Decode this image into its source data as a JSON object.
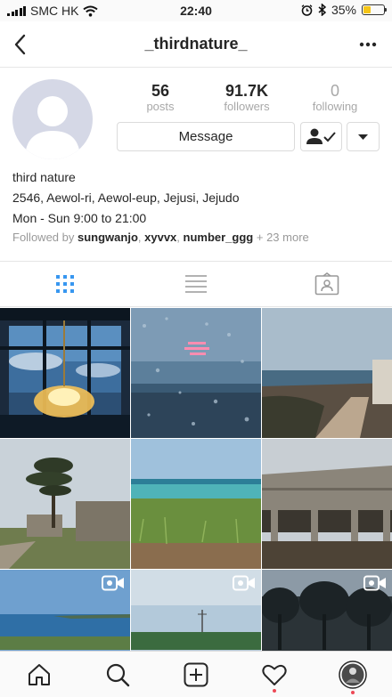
{
  "status_bar": {
    "carrier": "SMC HK",
    "time": "22:40",
    "battery_text": "35%",
    "battery_level": 0.35,
    "battery_color": "#f5c518",
    "icons": [
      "signal-bars",
      "wifi-icon",
      "alarm-icon",
      "bluetooth-icon",
      "battery-icon"
    ]
  },
  "nav": {
    "title": "_thirdnature_",
    "back_icon": "chevron-left-icon",
    "more_icon": "more-dots-icon"
  },
  "profile": {
    "stats": [
      {
        "value": "56",
        "label": "posts"
      },
      {
        "value": "91.7K",
        "label": "followers"
      },
      {
        "value": "0",
        "label": "following"
      }
    ],
    "message_label": "Message",
    "follow_icon": "person-check-icon",
    "dropdown_icon": "caret-down-icon",
    "name": "third nature",
    "address": "2546, Aewol-ri, Aewol-eup, Jejusi, Jejudo",
    "hours": "Mon - Sun 9:00 to 21:00",
    "followed_prefix": "Followed by",
    "followed_users": [
      "sungwanjo",
      "xyvvx",
      "number_ggg"
    ],
    "followed_more": "+ 23 more"
  },
  "view_tabs": [
    {
      "name": "grid-view",
      "icon": "grid-icon",
      "active": true
    },
    {
      "name": "list-view",
      "icon": "list-icon",
      "active": false
    },
    {
      "name": "tagged-view",
      "icon": "tagged-icon",
      "active": false
    }
  ],
  "posts": [
    {
      "subject": "chandelier-window",
      "video": false
    },
    {
      "subject": "rain-window-sea",
      "video": false
    },
    {
      "subject": "coastal-path",
      "video": false
    },
    {
      "subject": "pine-tree-ruins",
      "video": false
    },
    {
      "subject": "grass-coast",
      "video": false
    },
    {
      "subject": "concrete-building",
      "video": false
    },
    {
      "subject": "sea-horizon",
      "video": true
    },
    {
      "subject": "field-sky",
      "video": true
    },
    {
      "subject": "dark-forest",
      "video": true
    }
  ],
  "tab_bar": [
    {
      "name": "home",
      "icon": "home-icon"
    },
    {
      "name": "search",
      "icon": "search-icon"
    },
    {
      "name": "new-post",
      "icon": "plus-square-icon"
    },
    {
      "name": "activity",
      "icon": "heart-icon",
      "notification": true
    },
    {
      "name": "profile",
      "icon": "avatar-icon",
      "notification": true
    }
  ],
  "colors": {
    "accent_blue": "#3897f0",
    "muted_text": "#999999",
    "notification": "#ed4956"
  }
}
